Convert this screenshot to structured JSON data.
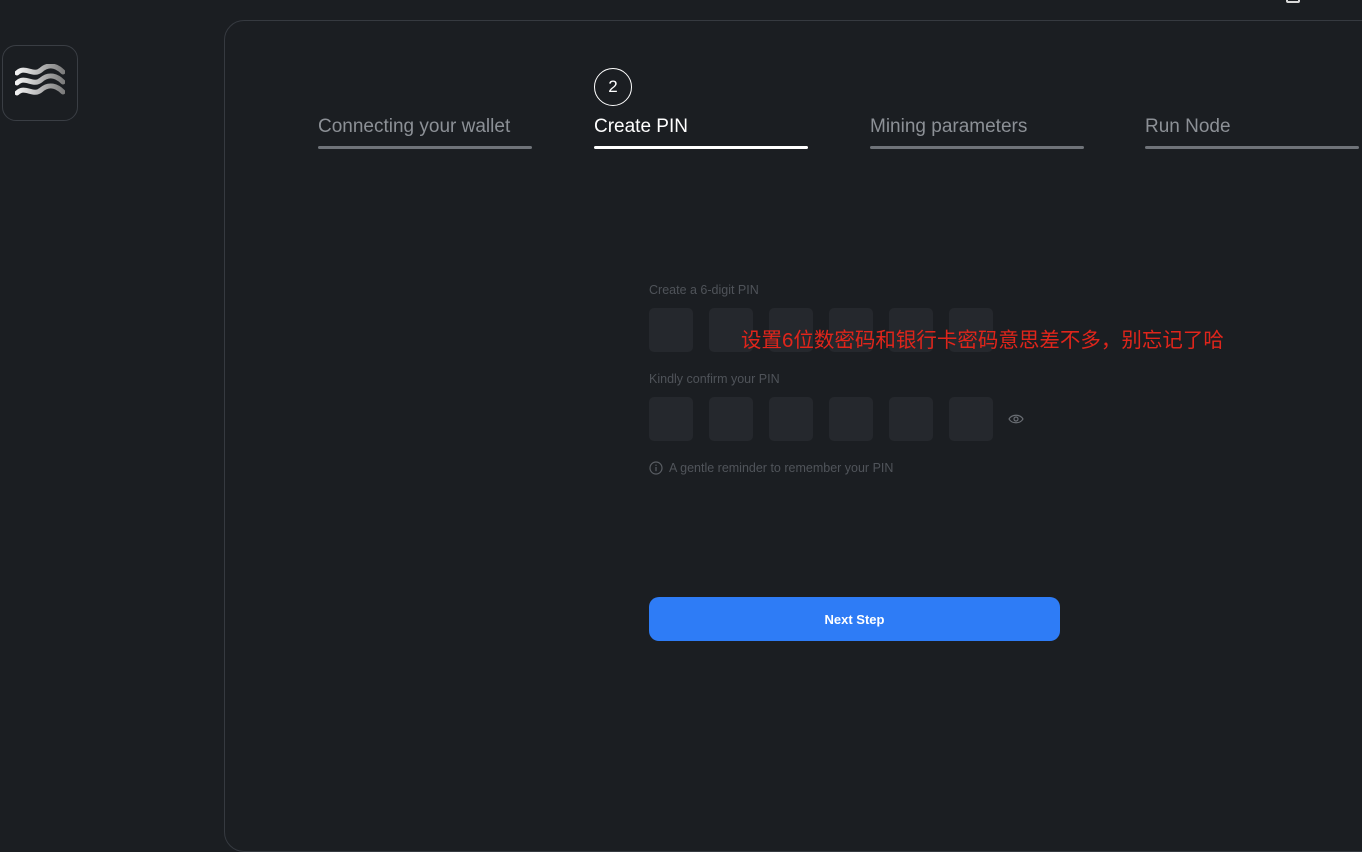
{
  "app": {
    "logo_icon": "wave-logo-icon"
  },
  "stepper": {
    "steps": [
      {
        "number": "",
        "label": "Connecting your wallet",
        "state": "inactive"
      },
      {
        "number": "2",
        "label": "Create PIN",
        "state": "active"
      },
      {
        "number": "",
        "label": "Mining parameters",
        "state": "inactive"
      },
      {
        "number": "",
        "label": "Run Node",
        "state": "inactive"
      }
    ]
  },
  "form": {
    "create_label": "Create a 6-digit PIN",
    "confirm_label": "Kindly confirm your PIN",
    "create_pin": [
      "",
      "",
      "",
      "",
      "",
      ""
    ],
    "confirm_pin": [
      "",
      "",
      "",
      "",
      "",
      ""
    ],
    "visibility_icon": "eye-icon",
    "reminder_icon": "info-icon",
    "reminder": "A gentle reminder to remember your PIN",
    "next_label": "Next Step"
  },
  "annotation": "设置6位数密码和银行卡密码意思差不多，别忘记了哈",
  "colors": {
    "accent": "#2e7cf6",
    "background": "#1b1e22",
    "input": "#25282d",
    "annotation": "#e0251b"
  }
}
